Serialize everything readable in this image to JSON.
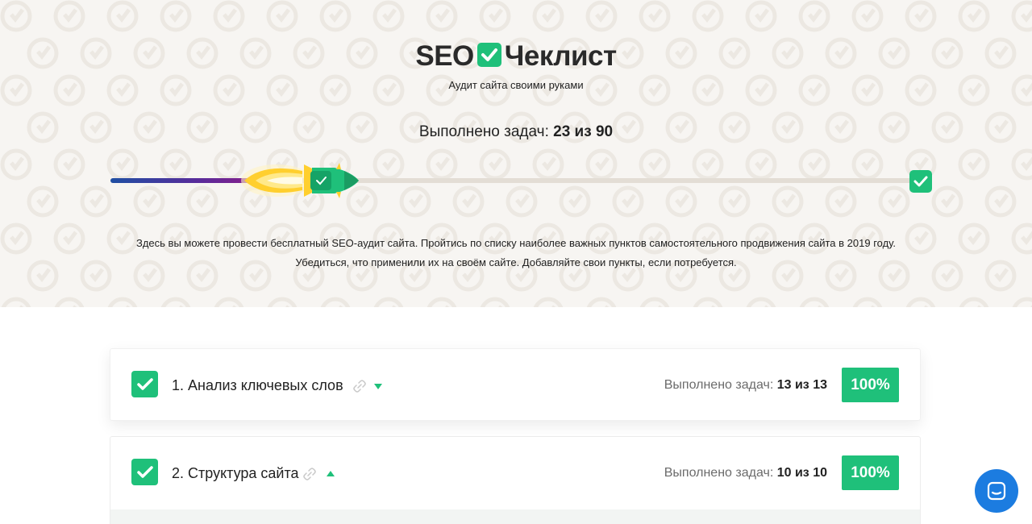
{
  "logo": {
    "left_text": "SEO",
    "right_text": "Чеклист",
    "tagline": "Аудит сайта своими руками"
  },
  "progress": {
    "label": "Выполнено задач:",
    "done": 23,
    "total": 90,
    "value_text": "23 из 90",
    "fraction": 0.2556
  },
  "description": {
    "line1": "Здесь вы можете провести бесплатный SEO-аудит сайта. Пройтись по списку наиболее важных пунктов самостоятельного продвижения сайта в 2019 году.",
    "line2": "Убедиться, что применили их на своём сайте. Добавляйте свои пункты, если потребуется."
  },
  "sections": [
    {
      "title": "1. Анализ ключевых слов",
      "stat_label": "Выполнено задач:",
      "stat_value": "13 из 13",
      "percent": "100%",
      "expanded": false
    },
    {
      "title": "2. Структура сайта",
      "stat_label": "Выполнено задач:",
      "stat_value": "10 из 10",
      "percent": "100%",
      "expanded": true
    }
  ],
  "colors": {
    "accent": "#1fc07a",
    "hero_bg": "#f7f5f2",
    "chat": "#1c7ce0"
  },
  "icons": [
    "check-icon",
    "link-icon",
    "caret-down-icon",
    "caret-up-icon",
    "chat-icon",
    "rocket-icon"
  ]
}
